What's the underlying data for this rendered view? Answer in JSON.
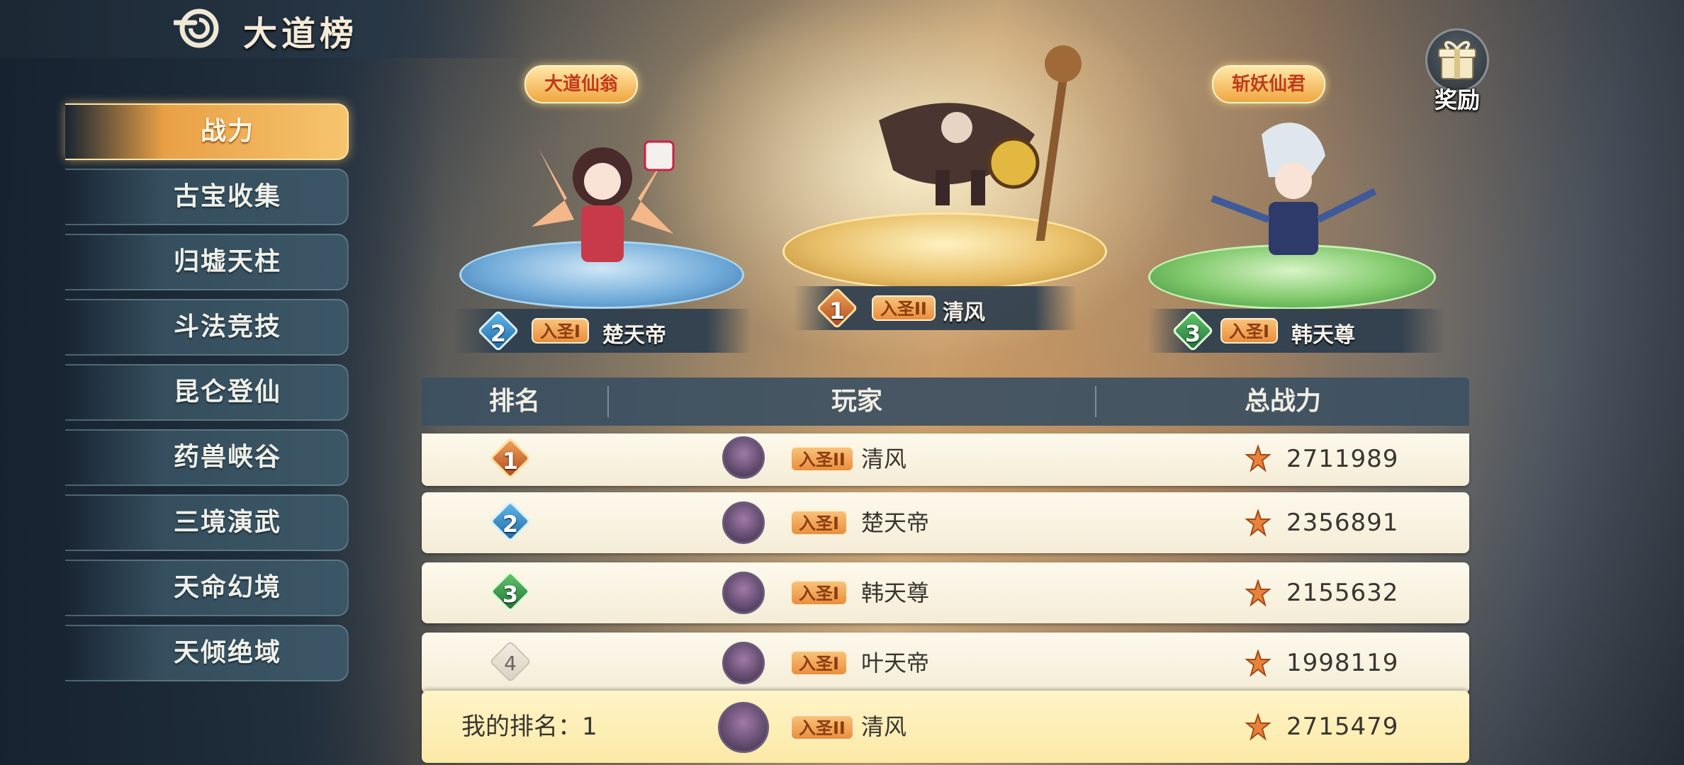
{
  "header": {
    "title": "大道榜"
  },
  "sidebar": {
    "items": [
      {
        "label": "战力",
        "active": true
      },
      {
        "label": "古宝收集"
      },
      {
        "label": "归墟天柱"
      },
      {
        "label": "斗法竞技"
      },
      {
        "label": "昆仑登仙"
      },
      {
        "label": "药兽峡谷"
      },
      {
        "label": "三境演武"
      },
      {
        "label": "天命幻境"
      },
      {
        "label": "天倾绝域"
      }
    ]
  },
  "reward": {
    "label": "奖励"
  },
  "podium": {
    "first": {
      "rank": "1",
      "badge": "入圣II",
      "name": "清风"
    },
    "second": {
      "rank": "2",
      "badge": "入圣I",
      "name": "楚天帝",
      "title": "大道仙翁"
    },
    "third": {
      "rank": "3",
      "badge": "入圣I",
      "name": "韩天尊",
      "title": "斩妖仙君"
    }
  },
  "table": {
    "headers": {
      "rank": "排名",
      "player": "玩家",
      "power": "总战力"
    },
    "rows": [
      {
        "rank": "1",
        "badge": "入圣II",
        "name": "清风",
        "power": "2711989"
      },
      {
        "rank": "2",
        "badge": "入圣I",
        "name": "楚天帝",
        "power": "2356891"
      },
      {
        "rank": "3",
        "badge": "入圣I",
        "name": "韩天尊",
        "power": "2155632"
      },
      {
        "rank": "4",
        "badge": "入圣I",
        "name": "叶天帝",
        "power": "1998119"
      }
    ]
  },
  "my_rank": {
    "label": "我的排名：1",
    "badge": "入圣II",
    "name": "清风",
    "power": "2715479"
  },
  "colors": {
    "accent": "#e9a045",
    "rank1": "#b24a1e",
    "rank2": "#1f6aa8",
    "rank3": "#21753a"
  }
}
